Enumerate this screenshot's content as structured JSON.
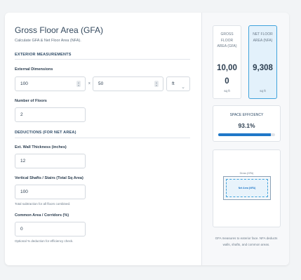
{
  "header": {
    "title": "Gross Floor Area (GFA)",
    "subtitle": "Calculate GFA & Net Floor Area (NFA)."
  },
  "sections": {
    "exterior": "EXTERIOR MEASUREMENTS",
    "deductions": "DEDUCTIONS (FOR NET AREA)"
  },
  "fields": {
    "dimensions": {
      "label": "External Dimensions",
      "length": "100",
      "times": "x",
      "width": "50",
      "unit": "ft"
    },
    "floors": {
      "label": "Number of Floors",
      "value": "2"
    },
    "wall_thickness": {
      "label": "Ext. Wall Thickness (inches)",
      "value": "12"
    },
    "shafts": {
      "label": "Vertical Shafts / Stairs (Total Sq Area)",
      "value": "100",
      "hint": "Total subtraction for all floors combined."
    },
    "common": {
      "label": "Common Area / Corridors (%)",
      "value": "0",
      "hint": "Optional % deduction for efficiency check."
    }
  },
  "results": {
    "gross": {
      "label": "GROSS FLOOR AREA (GFA)",
      "value": "10,000",
      "unit": "sq ft"
    },
    "net": {
      "label": "NET FLOOR AREA (NFA)",
      "value": "9,308",
      "unit": "sq ft"
    },
    "efficiency": {
      "label": "SPACE EFFICIENCY",
      "value": "93.1%",
      "percent": 93.1
    },
    "diagram": {
      "outer_label": "Gross (GFA)",
      "inner_label": "Net Area (NFA)"
    },
    "note": "GFA measures to exterior face. NFA deducts walls, shafts, and common areas."
  },
  "colors": {
    "accent": "#1f78c8",
    "net_border": "#41a3dc",
    "net_bg": "#e3f1fb"
  }
}
